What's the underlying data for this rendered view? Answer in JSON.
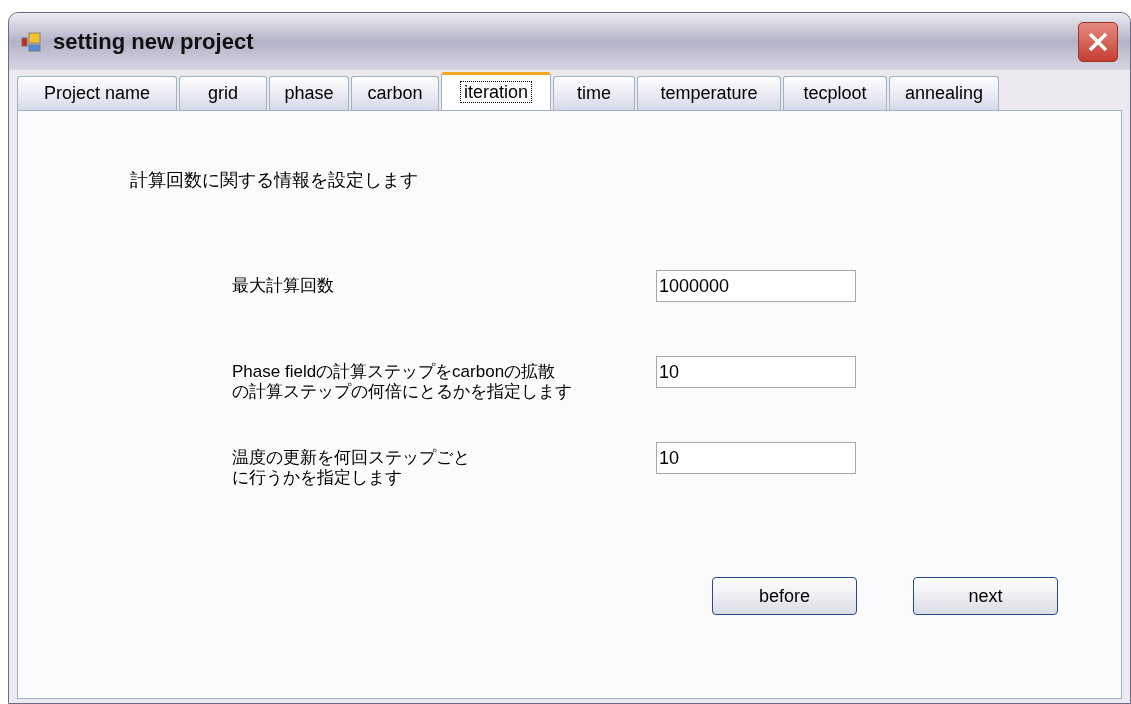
{
  "window": {
    "title": "setting new project"
  },
  "tabs": [
    {
      "label": "Project name",
      "selected": false
    },
    {
      "label": "grid",
      "selected": false
    },
    {
      "label": "phase",
      "selected": false
    },
    {
      "label": "carbon",
      "selected": false
    },
    {
      "label": "iteration",
      "selected": true
    },
    {
      "label": "time",
      "selected": false
    },
    {
      "label": "temperature",
      "selected": false
    },
    {
      "label": "tecploot",
      "selected": false
    },
    {
      "label": "annealing",
      "selected": false
    }
  ],
  "intro": "計算回数に関する情報を設定します",
  "fields": [
    {
      "label": [
        "最大計算回数"
      ],
      "value": "1000000"
    },
    {
      "label": [
        "Phase fieldの計算ステップをcarbonの拡散",
        "の計算ステップの何倍にとるかを指定します"
      ],
      "value": "10"
    },
    {
      "label": [
        "温度の更新を何回ステップごと",
        "に行うかを指定します"
      ],
      "value": "10"
    }
  ],
  "buttons": [
    "before",
    "next"
  ]
}
